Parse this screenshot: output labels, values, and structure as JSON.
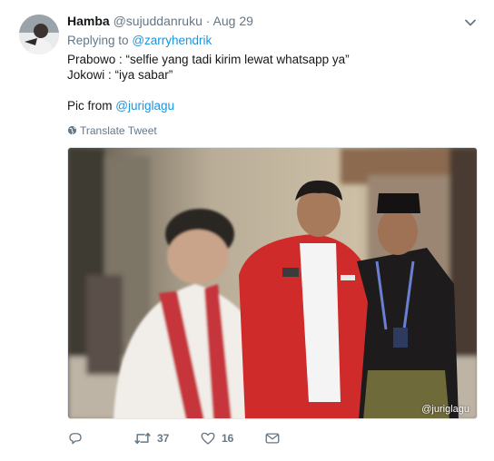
{
  "tweet": {
    "display_name": "Hamba",
    "handle": "@sujuddanruku",
    "separator": "·",
    "date": "Aug 29",
    "replying_prefix": "Replying to",
    "replying_to": "@zarryhendrik",
    "lines": [
      "Prabowo : “selfie yang tadi kirim lewat whatsapp ya”",
      "Jokowi : “iya sabar”"
    ],
    "pic_from_prefix": "Pic from",
    "pic_from_handle": "@juriglagu",
    "translate_label": "Translate Tweet",
    "image_watermark": "@juriglagu",
    "actions": {
      "reply_count": "",
      "retweet_count": "37",
      "like_count": "16"
    }
  },
  "icons": {
    "menu": "chevron-down-icon",
    "translate": "globe-icon",
    "reply": "reply-icon",
    "retweet": "retweet-icon",
    "like": "heart-icon",
    "dm": "envelope-icon"
  },
  "colors": {
    "link": "#1b95e0",
    "muted": "#657786",
    "text": "#14171a",
    "border": "#e1e8ed"
  }
}
